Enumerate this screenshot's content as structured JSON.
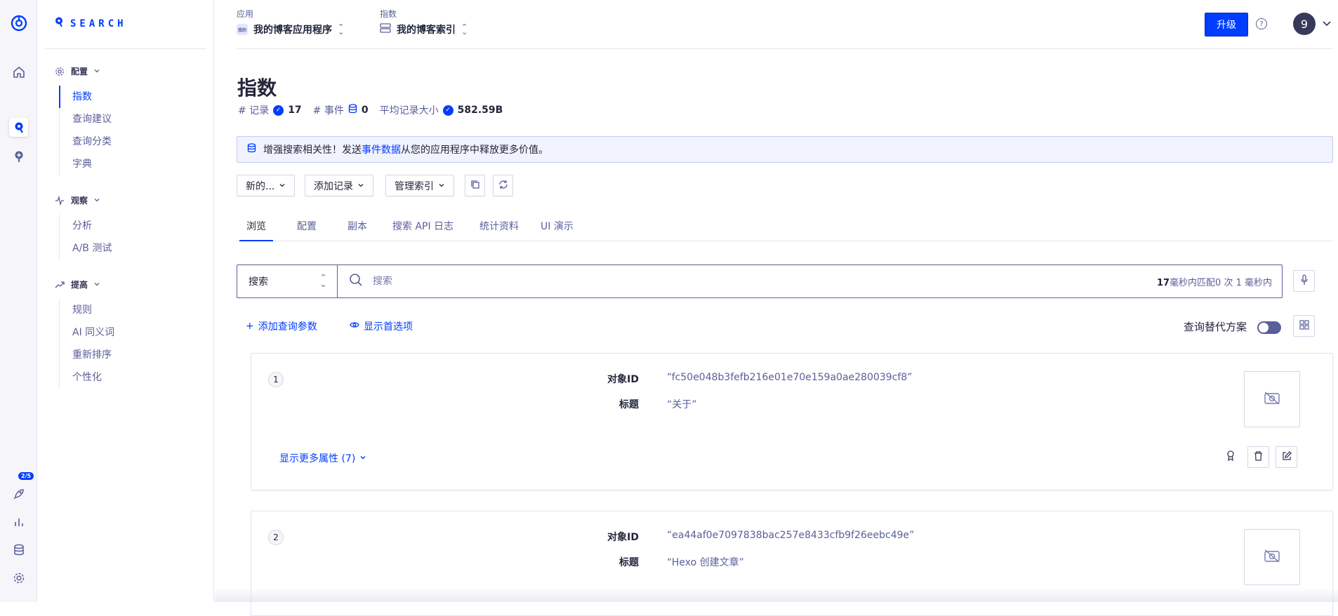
{
  "rail": {
    "badge": "2/5"
  },
  "brand": {
    "name": "SEARCH"
  },
  "sidebar": {
    "sections": [
      {
        "label": "配置",
        "items": [
          "指数",
          "查询建议",
          "查询分类",
          "字典"
        ]
      },
      {
        "label": "观察",
        "items": [
          "分析",
          "A/B 测试"
        ]
      },
      {
        "label": "提高",
        "items": [
          "规则",
          "AI 同义词",
          "重新排序",
          "个性化"
        ]
      }
    ]
  },
  "header": {
    "app_label": "应用",
    "app_badge": "我的",
    "app_value": "我的博客应用程序",
    "index_label": "指数",
    "index_value": "我的博客索引",
    "upgrade": "升级",
    "help": "?",
    "avatar": "9"
  },
  "page": {
    "title": "指数",
    "records_label": "# 记录",
    "records_value": "17",
    "events_label": "# 事件",
    "events_value": "0",
    "avg_label": "平均记录大小",
    "avg_value": "582.59B"
  },
  "banner": {
    "prefix": "增强搜索相关性！发送",
    "link": "事件数据",
    "suffix": "从您的应用程序中释放更多价值。"
  },
  "actions": {
    "new": "新的...",
    "add": "添加记录",
    "manage": "管理索引"
  },
  "tabs": [
    "浏览",
    "配置",
    "副本",
    "搜索 API 日志",
    "统计资料",
    "UI 演示"
  ],
  "search": {
    "type": "搜索",
    "placeholder": "搜索",
    "hits": "17",
    "meta_text": "毫秒内匹配0 次 1 毫秒内"
  },
  "tools": {
    "add_param": "添加查询参数",
    "show_pref": "显示首选项",
    "alt_label": "查询替代方案"
  },
  "records": [
    {
      "num": "1",
      "id_key": "对象ID",
      "id_val": "“fc50e048b3fefb216e01e70e159a0ae280039cf8”",
      "title_key": "标题",
      "title_val": "“关于”",
      "more": "显示更多属性 (7)"
    },
    {
      "num": "2",
      "id_key": "对象ID",
      "id_val": "“ea44af0e7097838bac257e8433cfb9f26eebc49e”",
      "title_key": "标题",
      "title_val": "“Hexo 创建文章”"
    }
  ],
  "colors": {
    "accent": "#003dff",
    "text": "#23263b",
    "muted": "#5a5e9a",
    "border": "#e4e5ef"
  }
}
